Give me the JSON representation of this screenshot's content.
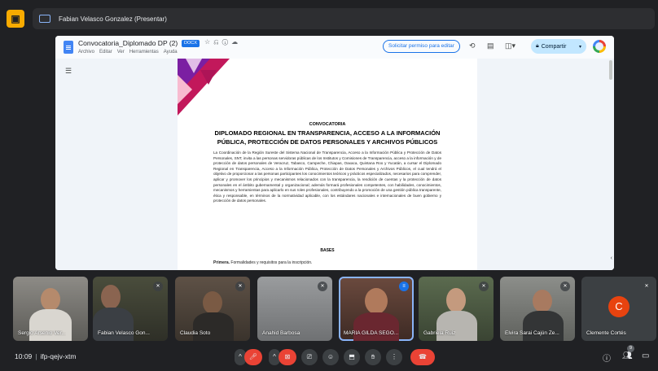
{
  "presenter": {
    "name": "Fabian Velasco Gonzalez (Presentar)"
  },
  "document": {
    "title": "Convocatoria_Diplomado DP (2)",
    "badge": "DOCX",
    "menu": [
      "Archivo",
      "Editar",
      "Ver",
      "Herramientas",
      "Ayuda"
    ],
    "request_edit_label": "Solicitar permiso para editar",
    "share_label": "Compartir",
    "convocatoria": "CONVOCATORIA",
    "title_line1": "DIPLOMADO REGIONAL EN TRANSPARENCIA, ACCESO A LA INFORMACIÓN",
    "title_line2": "PÚBLICA, PROTECCIÓN DE DATOS PERSONALES Y ARCHIVOS PÚBLICOS",
    "body": "La Coordinación de la Región Sureste del Sistema Nacional de Transparencia, Acceso a la Información Pública y Protección de Datos Personales, SNT, invita a las personas servidoras públicas de los Institutos y Comisiones de Transparencia, acceso a la información y de protección de datos personales de Veracruz, Tabasco, Campeche, Chiapas, Oaxaca, Quintana Roo y Yucatán, a cursar el Diplomado Regional en Transparencia, Acceso a la Información Pública, Protección de Datos Personales y Archivos Públicos, el cual tendrá el objetivo de proporcionar a las personas participantes los conocimientos teóricos y prácticos especializados, necesarios para comprender, aplicar y promover los principios y mecanismos relacionados con la transparencia, la rendición de cuentas y la protección de datos personales en el ámbito gubernamental y organizacional; además formará profesionales competentes, con habilidades, conocimientos, mecanismos y herramientas para aplicarlo en sus roles profesionales, contribuyendo a la promoción de una gestión pública transparente, ética y responsable, en términos de la normatividad aplicable, con los estándares nacionales e internacionales de buen gobierno y protección de datos personales.",
    "bases_heading": "BASES",
    "primera_label": "Primera.",
    "primera_text": " Formalidades y requisitos para la inscripción."
  },
  "participants": [
    {
      "name": "Sergio Arsenio Ver...",
      "muted": false
    },
    {
      "name": "Fabian Velasco Gon...",
      "muted": true
    },
    {
      "name": "Claudia Soto",
      "muted": true
    },
    {
      "name": "Anahid Barbosa",
      "muted": true
    },
    {
      "name": "MARIA GILDA SEGO...",
      "muted": false,
      "speaking": true
    },
    {
      "name": "Gabriela Ruiz",
      "muted": true
    },
    {
      "name": "Elvira Sarai Cajún Ze...",
      "muted": true
    },
    {
      "name": "Clemente Cortés",
      "muted": true,
      "initial": "C"
    }
  ],
  "bottom_bar": {
    "time": "10:09",
    "meeting_code": "ifp-qejv-xtm",
    "participant_count": "9"
  },
  "colors": {
    "background": "#202124",
    "hangup": "#ea4335",
    "avatar_c": "#e8430f",
    "speaking_border": "#8ab4f8"
  }
}
